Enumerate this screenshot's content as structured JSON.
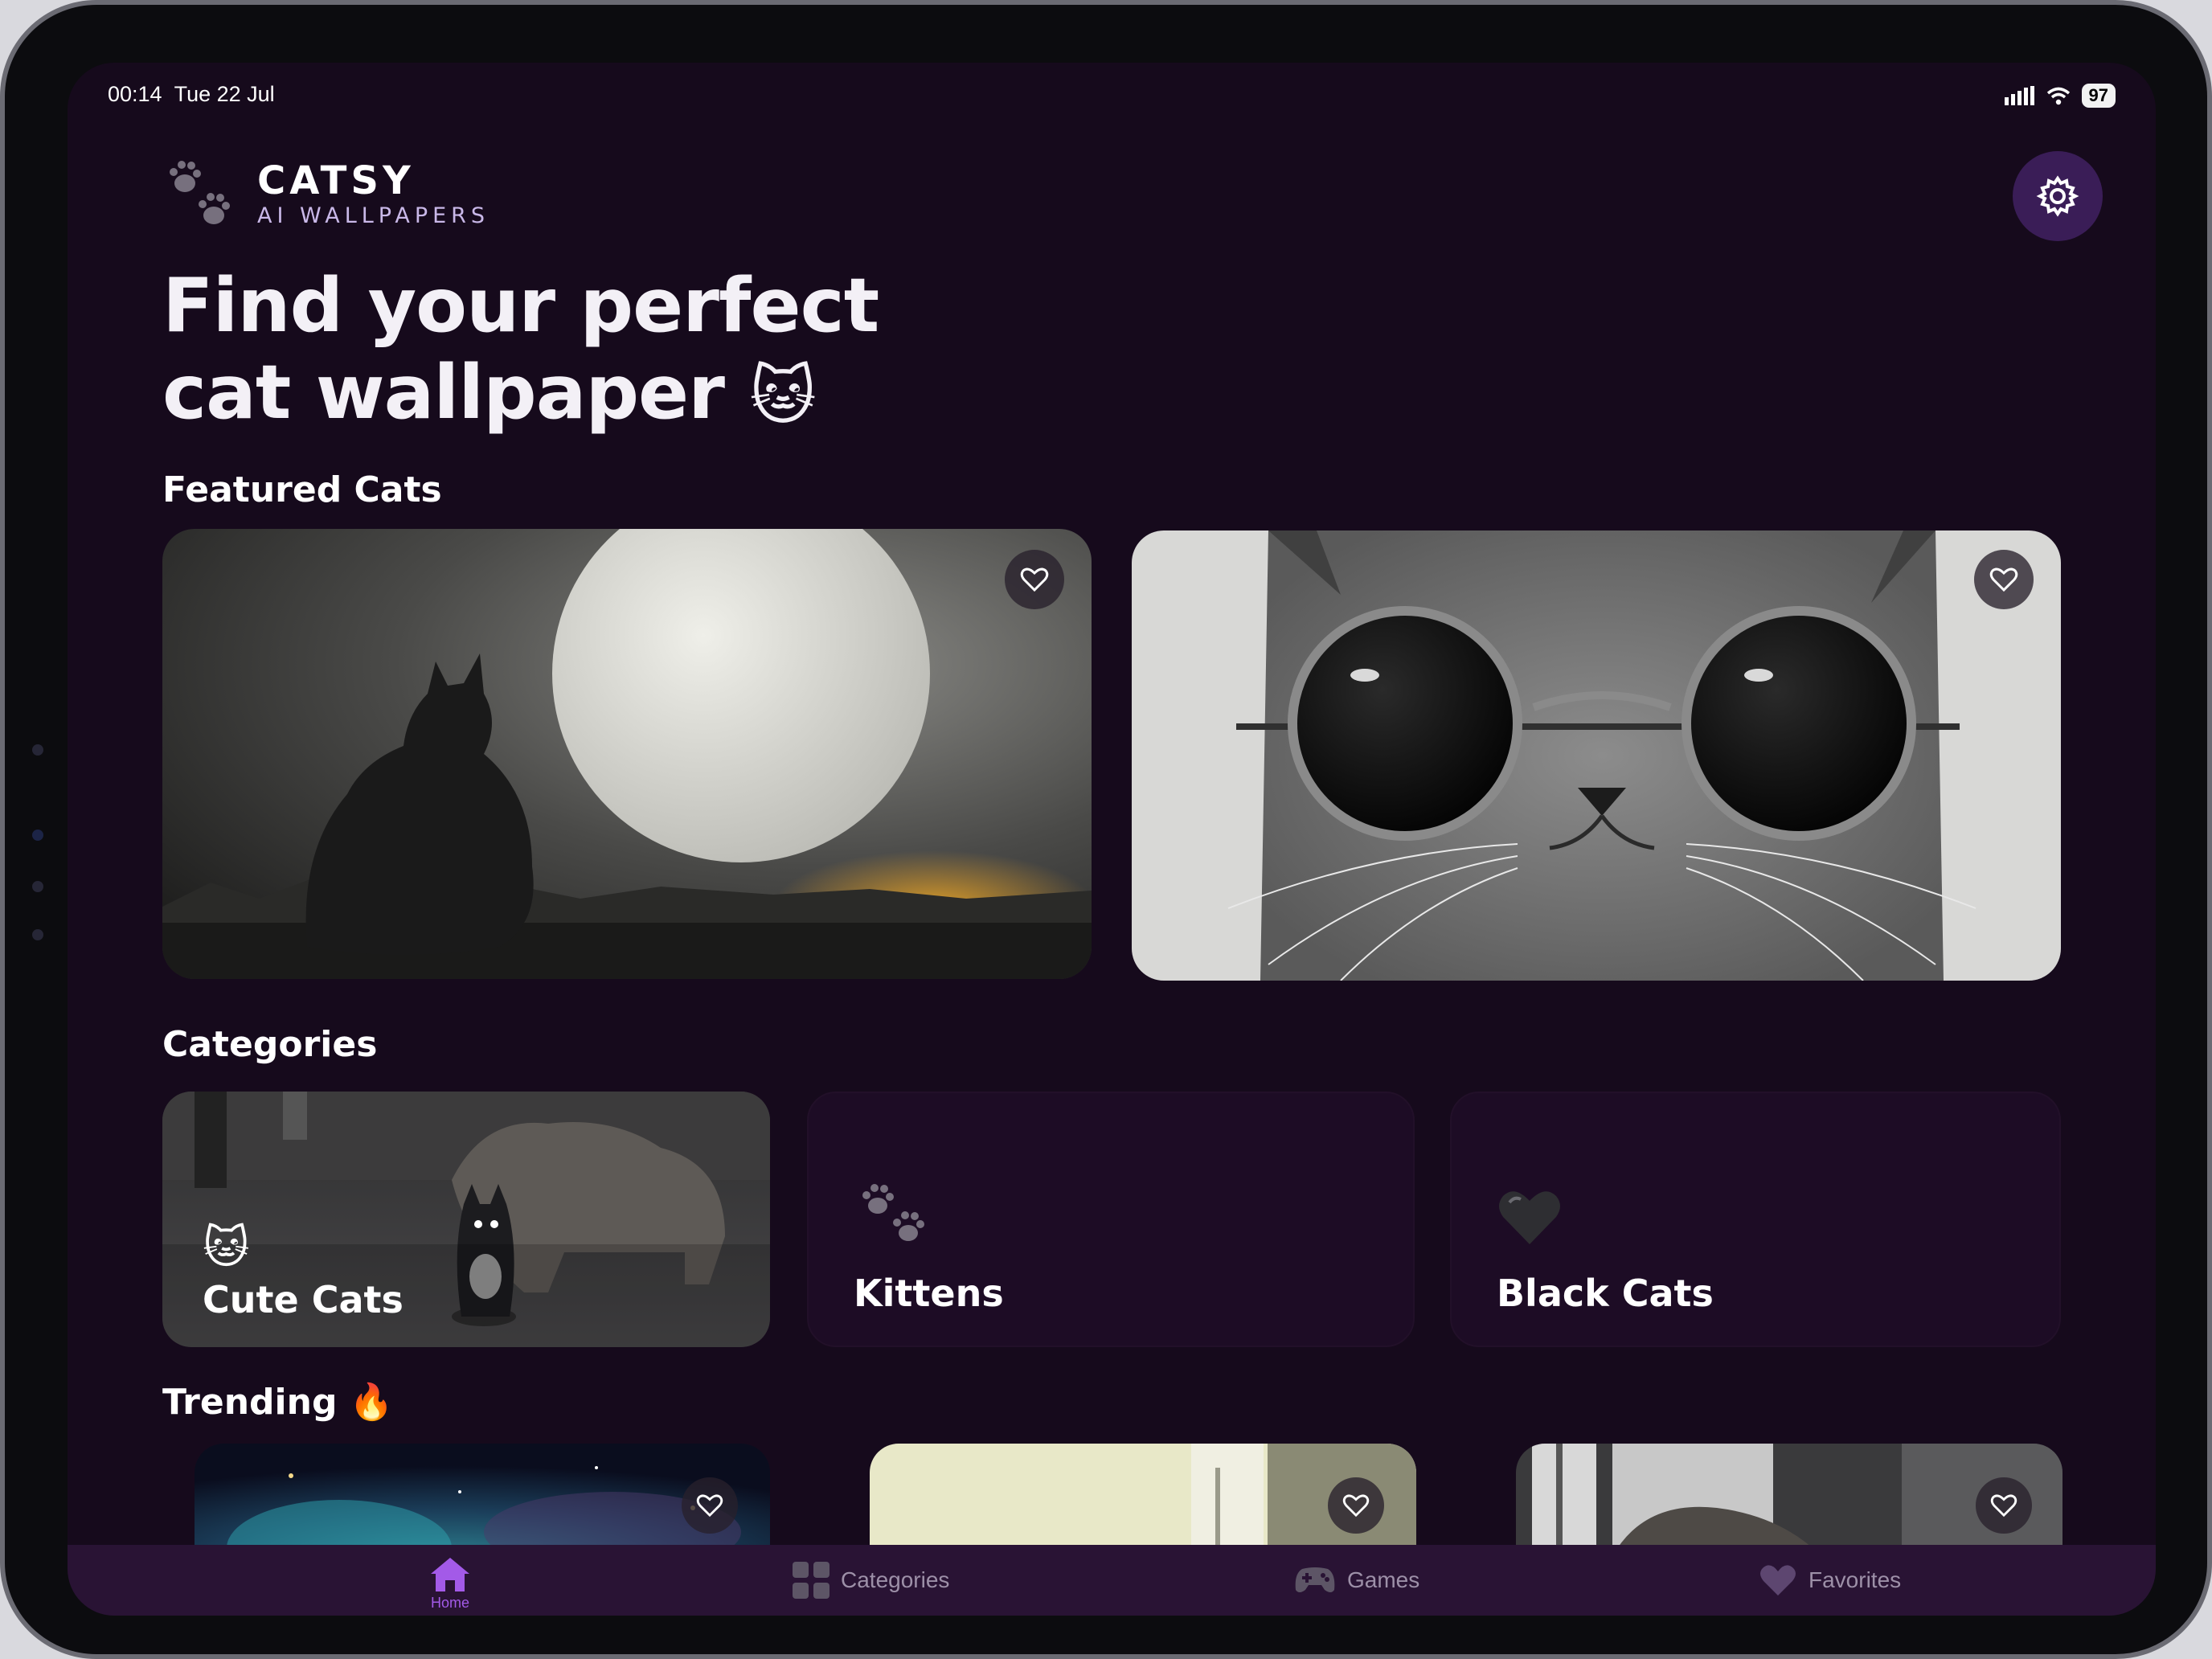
{
  "status_bar": {
    "time": "00:14",
    "date": "Tue 22 Jul",
    "battery": "97"
  },
  "header": {
    "brand_name": "CATSY",
    "brand_subtitle": "AI WALLPAPERS",
    "settings_icon": "gear-icon"
  },
  "hero": {
    "line1": "Find your perfect",
    "line2": "cat wallpaper",
    "emoji": "🐱"
  },
  "featured": {
    "title": "Featured Cats"
  },
  "categories": {
    "title": "Categories",
    "items": [
      {
        "label": "Cute Cats",
        "emoji": "🐱"
      },
      {
        "label": "Kittens",
        "emoji": "🐾"
      },
      {
        "label": "Black Cats",
        "emoji": "🖤"
      }
    ]
  },
  "trending": {
    "title": "Trending",
    "emoji": "🔥"
  },
  "tabbar": {
    "items": [
      {
        "label": "Home",
        "icon": "home-icon",
        "active": true
      },
      {
        "label": "Categories",
        "icon": "grid-icon"
      },
      {
        "label": "Games",
        "icon": "gamepad-icon"
      },
      {
        "label": "Favorites",
        "icon": "heart-icon"
      }
    ]
  },
  "colors": {
    "background": "#160a1c",
    "accent": "#a35ae8",
    "tabbar": "#291334",
    "settings_button": "#3a1d57"
  }
}
